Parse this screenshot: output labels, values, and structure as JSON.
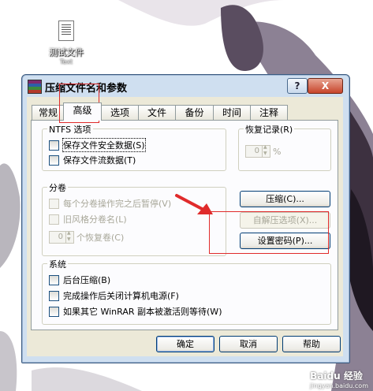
{
  "desktop": {
    "file_icon_label": "测试文件",
    "file_icon_sublabel": "Text"
  },
  "dialog": {
    "title": "压缩文件名和参数",
    "help_button": "?",
    "close_button": "X"
  },
  "tabs": [
    "常规",
    "高级",
    "选项",
    "文件",
    "备份",
    "时间",
    "注释"
  ],
  "active_tab": "高级",
  "ntfs": {
    "title": "NTFS 选项",
    "save_security": "保存文件安全数据(S)",
    "save_streams": "保存文件流数据(T)"
  },
  "recovery": {
    "title": "恢复记录(R)",
    "value": "0",
    "unit": "%"
  },
  "volumes": {
    "title": "分卷",
    "pause_after_each": "每个分卷操作完之后暂停(V)",
    "old_style_names": "旧风格分卷名(L)",
    "recovery_volumes_value": "0",
    "recovery_volumes_label": "个恢复卷(C)"
  },
  "side_buttons": {
    "compress": "压缩(C)...",
    "sfx_options": "自解压选项(X)...",
    "set_password": "设置密码(P)..."
  },
  "system": {
    "title": "系统",
    "background": "后台压缩(B)",
    "shutdown": "完成操作后关闭计算机电源(F)",
    "wait_other": "如果其它 WinRAR 副本被激活则等待(W)"
  },
  "footer": {
    "ok": "确定",
    "cancel": "取消",
    "help": "帮助"
  },
  "watermark": {
    "brand": "Baidu 经验",
    "url": "jingyan.baidu.com"
  },
  "colors": {
    "annotation": "#e02b2b",
    "titlebar": "#cfdff0",
    "client": "#ece9d8"
  }
}
